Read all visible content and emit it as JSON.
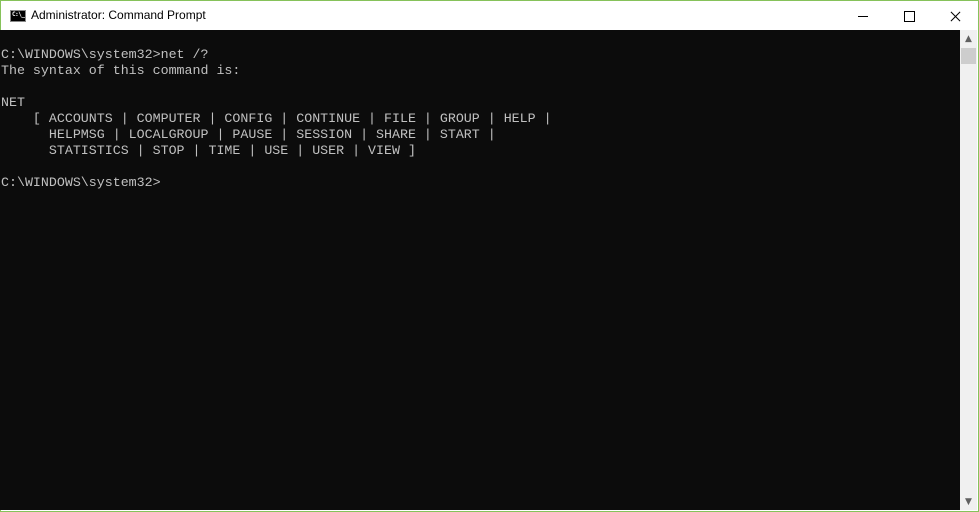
{
  "window": {
    "title": "Administrator: Command Prompt",
    "icon": "cmd-icon",
    "icon_label": "C:\\_",
    "controls": {
      "minimize": "minimize-icon",
      "maximize": "maximize-icon",
      "close": "close-icon"
    },
    "accent_border": "#86c25a"
  },
  "console": {
    "background": "#0c0c0c",
    "foreground": "#c0c0c0",
    "lines": [
      "C:\\WINDOWS\\system32>net /?",
      "The syntax of this command is:",
      "",
      "NET",
      "    [ ACCOUNTS | COMPUTER | CONFIG | CONTINUE | FILE | GROUP | HELP |",
      "      HELPMSG | LOCALGROUP | PAUSE | SESSION | SHARE | START |",
      "      STATISTICS | STOP | TIME | USE | USER | VIEW ]",
      "",
      "C:\\WINDOWS\\system32>"
    ]
  },
  "scrollbar": {
    "up": "▲",
    "down": "▼"
  }
}
